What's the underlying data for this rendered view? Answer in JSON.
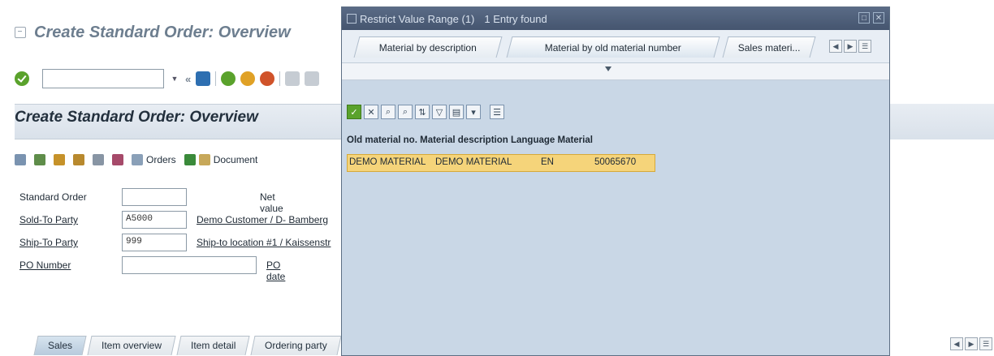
{
  "window": {
    "title": "Create Standard Order: Overview"
  },
  "toolbar": {
    "command_value": "",
    "icons": [
      "enter-icon",
      "save-icon",
      "back-icon",
      "exit-icon",
      "cancel-icon",
      "print-icon",
      "find-icon"
    ]
  },
  "content": {
    "title": "Create Standard Order: Overview",
    "buttons": {
      "orders": "Orders",
      "document": "Document"
    }
  },
  "form": {
    "standard_order_label": "Standard Order",
    "standard_order_value": "",
    "net_value_label": "Net value",
    "sold_to_label": "Sold-To Party",
    "sold_to_value": "A5000",
    "sold_to_desc": "Demo Customer / D- Bamberg",
    "ship_to_label": "Ship-To Party",
    "ship_to_value": "999",
    "ship_to_desc": "Ship-to location #1 / Kaissenstr",
    "po_number_label": "PO Number",
    "po_number_value": "",
    "po_date_label": "PO date"
  },
  "tabs": [
    "Sales",
    "Item overview",
    "Item detail",
    "Ordering party"
  ],
  "popup": {
    "title": "Restrict Value Range (1)",
    "entries": "1 Entry found",
    "tabs": [
      "Material by description",
      "Material by old material number",
      "Sales materi..."
    ],
    "headers": [
      "Old material no.",
      "Material description",
      "Language",
      "Material"
    ],
    "row": {
      "old_material": "DEMO MATERIAL",
      "description": "DEMO MATERIAL",
      "language": "EN",
      "material": "50065670"
    }
  }
}
